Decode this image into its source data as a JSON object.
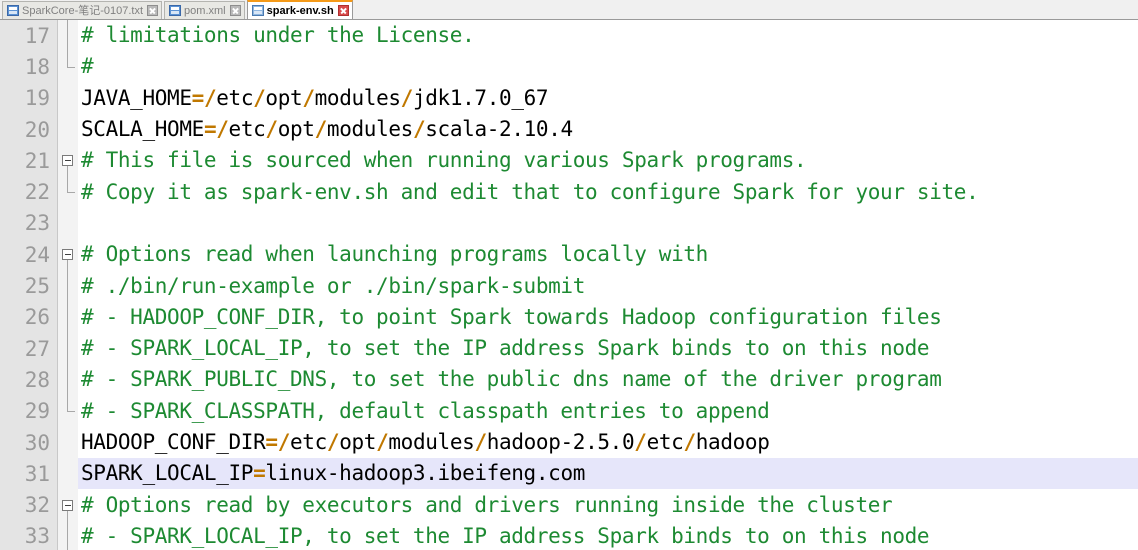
{
  "window": {
    "app": "text-editor",
    "accent_color": "#f59a18",
    "current_line_highlight": "#e6e6fa",
    "comment_color": "#1d8a32",
    "operator_color": "#c07800"
  },
  "tabbar": {
    "tabs": [
      {
        "label": "SparkCore-笔记-0107.txt",
        "icon": "file-icon",
        "close_icon": "close-icon",
        "active": false
      },
      {
        "label": "pom.xml",
        "icon": "file-icon",
        "close_icon": "close-icon",
        "active": false
      },
      {
        "label": "spark-env.sh",
        "icon": "file-saved-icon",
        "close_icon": "close-icon",
        "active": true
      }
    ]
  },
  "editor": {
    "first_visible_line": 17,
    "current_line": 31,
    "lines": [
      {
        "num": "17",
        "fold": "vline-bottom-only",
        "current": false,
        "parts": [
          {
            "t": "cmt",
            "s": "# limitations under the License."
          }
        ]
      },
      {
        "num": "18",
        "fold": "elbow",
        "current": false,
        "parts": [
          {
            "t": "cmt",
            "s": "#"
          }
        ]
      },
      {
        "num": "19",
        "fold": "none",
        "current": false,
        "parts": [
          {
            "t": "txt",
            "s": "JAVA_HOME"
          },
          {
            "t": "op",
            "s": "="
          },
          {
            "t": "op",
            "s": "/"
          },
          {
            "t": "txt",
            "s": "etc"
          },
          {
            "t": "op",
            "s": "/"
          },
          {
            "t": "txt",
            "s": "opt"
          },
          {
            "t": "op",
            "s": "/"
          },
          {
            "t": "txt",
            "s": "modules"
          },
          {
            "t": "op",
            "s": "/"
          },
          {
            "t": "txt",
            "s": "jdk1.7.0_67"
          }
        ]
      },
      {
        "num": "20",
        "fold": "none",
        "current": false,
        "parts": [
          {
            "t": "txt",
            "s": "SCALA_HOME"
          },
          {
            "t": "op",
            "s": "="
          },
          {
            "t": "op",
            "s": "/"
          },
          {
            "t": "txt",
            "s": "etc"
          },
          {
            "t": "op",
            "s": "/"
          },
          {
            "t": "txt",
            "s": "opt"
          },
          {
            "t": "op",
            "s": "/"
          },
          {
            "t": "txt",
            "s": "modules"
          },
          {
            "t": "op",
            "s": "/"
          },
          {
            "t": "txt",
            "s": "scala-2.10.4"
          }
        ]
      },
      {
        "num": "21",
        "fold": "box",
        "current": false,
        "parts": [
          {
            "t": "cmt",
            "s": "# This file is sourced when running various Spark programs."
          }
        ]
      },
      {
        "num": "22",
        "fold": "elbow",
        "current": false,
        "parts": [
          {
            "t": "cmt",
            "s": "# Copy it as spark-env.sh and edit that to configure Spark for your site."
          }
        ]
      },
      {
        "num": "23",
        "fold": "none",
        "current": false,
        "parts": []
      },
      {
        "num": "24",
        "fold": "box",
        "current": false,
        "parts": [
          {
            "t": "cmt",
            "s": "# Options read when launching programs locally with"
          }
        ]
      },
      {
        "num": "25",
        "fold": "vline",
        "current": false,
        "parts": [
          {
            "t": "cmt",
            "s": "# ./bin/run-example or ./bin/spark-submit"
          }
        ]
      },
      {
        "num": "26",
        "fold": "vline",
        "current": false,
        "parts": [
          {
            "t": "cmt",
            "s": "# - HADOOP_CONF_DIR, to point Spark towards Hadoop configuration files"
          }
        ]
      },
      {
        "num": "27",
        "fold": "vline",
        "current": false,
        "parts": [
          {
            "t": "cmt",
            "s": "# - SPARK_LOCAL_IP, to set the IP address Spark binds to on this node"
          }
        ]
      },
      {
        "num": "28",
        "fold": "vline",
        "current": false,
        "parts": [
          {
            "t": "cmt",
            "s": "# - SPARK_PUBLIC_DNS, to set the public dns name of the driver program"
          }
        ]
      },
      {
        "num": "29",
        "fold": "elbow",
        "current": false,
        "parts": [
          {
            "t": "cmt",
            "s": "# - SPARK_CLASSPATH, default classpath entries to append"
          }
        ]
      },
      {
        "num": "30",
        "fold": "none",
        "current": false,
        "parts": [
          {
            "t": "txt",
            "s": "HADOOP_CONF_DIR"
          },
          {
            "t": "op",
            "s": "="
          },
          {
            "t": "op",
            "s": "/"
          },
          {
            "t": "txt",
            "s": "etc"
          },
          {
            "t": "op",
            "s": "/"
          },
          {
            "t": "txt",
            "s": "opt"
          },
          {
            "t": "op",
            "s": "/"
          },
          {
            "t": "txt",
            "s": "modules"
          },
          {
            "t": "op",
            "s": "/"
          },
          {
            "t": "txt",
            "s": "hadoop-2.5.0"
          },
          {
            "t": "op",
            "s": "/"
          },
          {
            "t": "txt",
            "s": "etc"
          },
          {
            "t": "op",
            "s": "/"
          },
          {
            "t": "txt",
            "s": "hadoop"
          }
        ]
      },
      {
        "num": "31",
        "fold": "none",
        "current": true,
        "parts": [
          {
            "t": "txt",
            "s": "SPARK_LOCAL_IP"
          },
          {
            "t": "op",
            "s": "="
          },
          {
            "t": "txt",
            "s": "linux-hadoop3.ibeifeng.com"
          }
        ]
      },
      {
        "num": "32",
        "fold": "box",
        "current": false,
        "parts": [
          {
            "t": "cmt",
            "s": "# Options read by executors and drivers running inside the cluster"
          }
        ]
      },
      {
        "num": "33",
        "fold": "vline",
        "current": false,
        "parts": [
          {
            "t": "cmt",
            "s": "# - SPARK_LOCAL_IP, to set the IP address Spark binds to on this node"
          }
        ]
      }
    ]
  }
}
